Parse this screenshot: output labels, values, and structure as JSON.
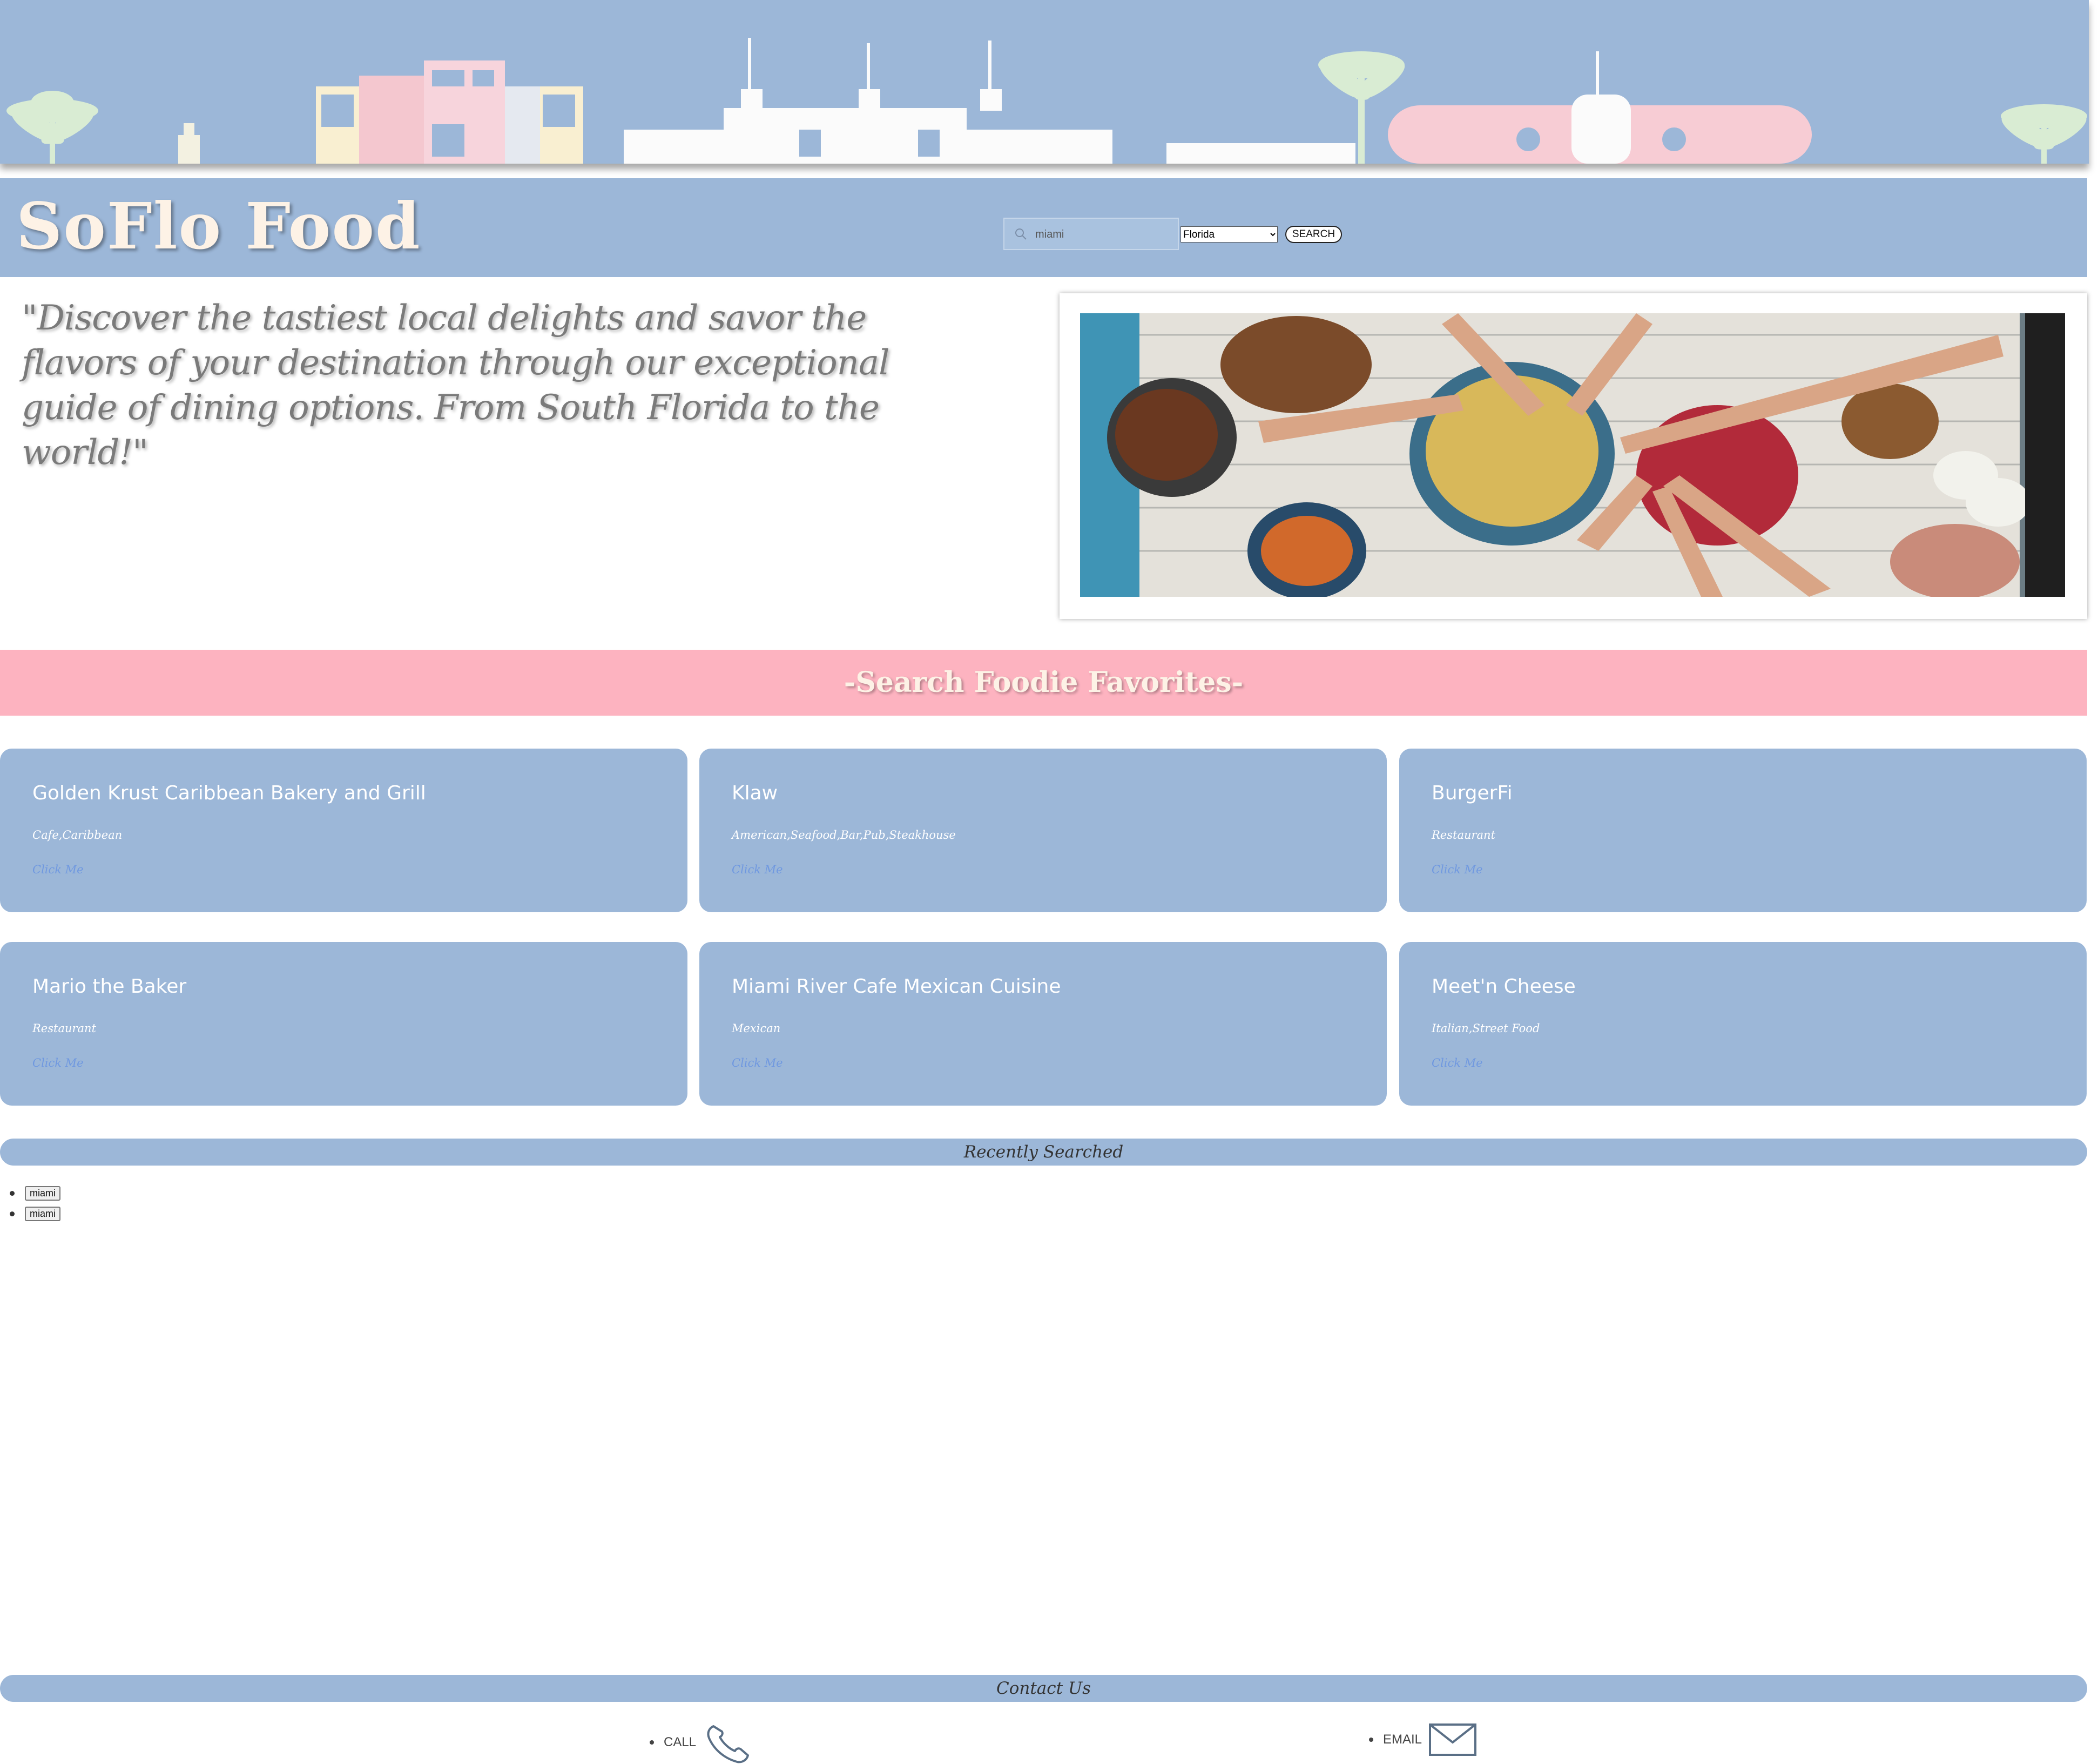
{
  "header": {
    "site_title": "SoFlo Food",
    "search": {
      "value": "miami",
      "placeholder": ""
    },
    "state_select": {
      "selected": "Florida"
    },
    "search_button": "SEARCH"
  },
  "hero": {
    "quote": "\"Discover the tastiest local delights and savor the flavors of your destination through our exceptional guide of dining options. From South Florida to the world!\""
  },
  "favorites": {
    "heading": "-Search Foodie Favorites-",
    "cards": [
      {
        "name": "Golden Krust Caribbean Bakery and Grill",
        "categories": "Cafe,Caribbean",
        "link": "Click Me"
      },
      {
        "name": "Klaw",
        "categories": "American,Seafood,Bar,Pub,Steakhouse",
        "link": "Click Me"
      },
      {
        "name": "BurgerFi",
        "categories": "Restaurant",
        "link": "Click Me"
      },
      {
        "name": "Mario the Baker",
        "categories": "Restaurant",
        "link": "Click Me"
      },
      {
        "name": "Miami River Cafe Mexican Cuisine",
        "categories": "Mexican",
        "link": "Click Me"
      },
      {
        "name": "Meet'n Cheese",
        "categories": "Italian,Street Food",
        "link": "Click Me"
      }
    ]
  },
  "recent": {
    "heading": "Recently Searched",
    "items": [
      "miami",
      "miami"
    ]
  },
  "contact": {
    "heading": "Contact Us",
    "call_label": "CALL",
    "email_label": "EMAIL"
  },
  "icons": {
    "search": "search-icon",
    "call": "phone-icon",
    "email": "envelope-icon"
  },
  "colors": {
    "banner_blue": "#9cb7d8",
    "pink_band": "#fdb3c0",
    "title_cream": "#fdf2e6",
    "link_blue": "#6f98e0"
  }
}
